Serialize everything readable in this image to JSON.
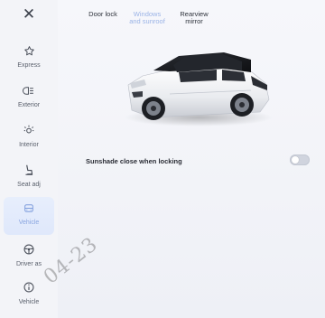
{
  "sidebar": {
    "close_icon": "close-icon",
    "items": [
      {
        "label": "Express",
        "icon": "star-icon",
        "active": false
      },
      {
        "label": "Exterior",
        "icon": "headlight-icon",
        "active": false
      },
      {
        "label": "Interior",
        "icon": "interior-light-icon",
        "active": false
      },
      {
        "label": "Seat adj",
        "icon": "seat-icon",
        "active": false
      },
      {
        "label": "Vehicle",
        "icon": "vehicle-icon",
        "active": true
      },
      {
        "label": "Driver as",
        "icon": "steering-wheel-icon",
        "active": false
      },
      {
        "label": "Vehicle",
        "icon": "info-icon",
        "active": false
      }
    ]
  },
  "tabs": [
    {
      "line1": "Door lock",
      "line2": "",
      "selected": false
    },
    {
      "line1": "Windows",
      "line2": "and sunroof",
      "selected": true
    },
    {
      "line1": "Rearview",
      "line2": "mirror",
      "selected": false
    }
  ],
  "settings": {
    "sunshade_label": "Sunshade close when locking",
    "sunshade_enabled": false
  },
  "watermark": "04-23",
  "colors": {
    "accent": "#8aa6e0",
    "active_bg": "#e4ecfb",
    "toggle_off": "#d0d4de"
  }
}
